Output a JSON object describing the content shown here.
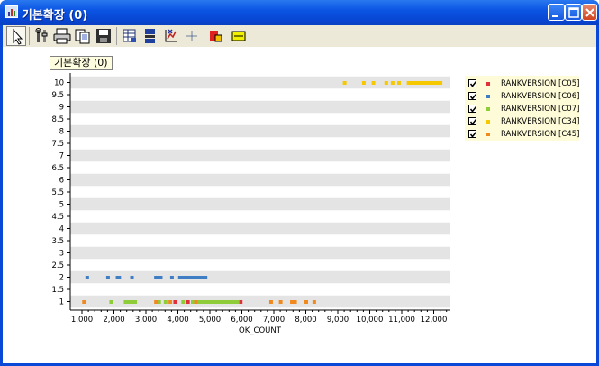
{
  "window": {
    "title": "기본확장 (0)"
  },
  "toolbar": {
    "tools": [
      "pointer",
      "properties",
      "print",
      "copy",
      "save",
      "data-view",
      "series-edit",
      "axis-scale",
      "crosshair",
      "export",
      "legend"
    ]
  },
  "chart_data": {
    "type": "scatter",
    "title": "기본확장 (0)",
    "xlabel": "OK_COUNT",
    "ylabel": "",
    "xlim": [
      900,
      12600
    ],
    "ylim": [
      0.7,
      10.2
    ],
    "x_ticks": [
      "1,000",
      "2,000",
      "3,000",
      "4,000",
      "5,000",
      "6,000",
      "7,000",
      "8,000",
      "9,000",
      "10,000",
      "11,000",
      "12,000"
    ],
    "y_ticks": [
      "1",
      "1.5",
      "2",
      "2.5",
      "3",
      "3.5",
      "4",
      "4.5",
      "5",
      "5.5",
      "6",
      "6.5",
      "7",
      "7.5",
      "8",
      "8.5",
      "9",
      "9.5",
      "10"
    ],
    "legend_position": "right",
    "grid": "horizontal bands",
    "series": [
      {
        "name": "RANKVERSION [C05]",
        "color": "#e0303a",
        "y": 1,
        "x": [
          3900,
          4300,
          5950
        ]
      },
      {
        "name": "RANKVERSION [C06]",
        "color": "#3f7dc4",
        "y": 2,
        "x": [
          1150,
          1800,
          2100,
          2150,
          2550,
          3300,
          3350,
          3450,
          3800,
          4050,
          4150,
          4250,
          4350,
          4450,
          4550,
          4650,
          4750,
          4850
        ]
      },
      {
        "name": "RANKVERSION [C07]",
        "color": "#8fcc3a",
        "y": 1,
        "x": [
          1900,
          2350,
          2450,
          2550,
          2650,
          3400,
          3600,
          4150,
          4450,
          4650,
          4750,
          4850,
          4950,
          5050,
          5150,
          5250,
          5350,
          5450,
          5550,
          5650,
          5750,
          5850
        ]
      },
      {
        "name": "RANKVERSION [C34]",
        "color": "#f5c800",
        "y": 10,
        "x": [
          9200,
          9800,
          10100,
          10500,
          10700,
          10900,
          11200,
          11300,
          11400,
          11500,
          11600,
          11700,
          11800,
          11900,
          12000,
          12100,
          12200
        ]
      },
      {
        "name": "RANKVERSION [C45]",
        "color": "#f08a1e",
        "y": 1,
        "x": [
          1050,
          3300,
          3750,
          4550,
          6900,
          7200,
          7550,
          7650,
          8000,
          8250
        ]
      }
    ]
  }
}
